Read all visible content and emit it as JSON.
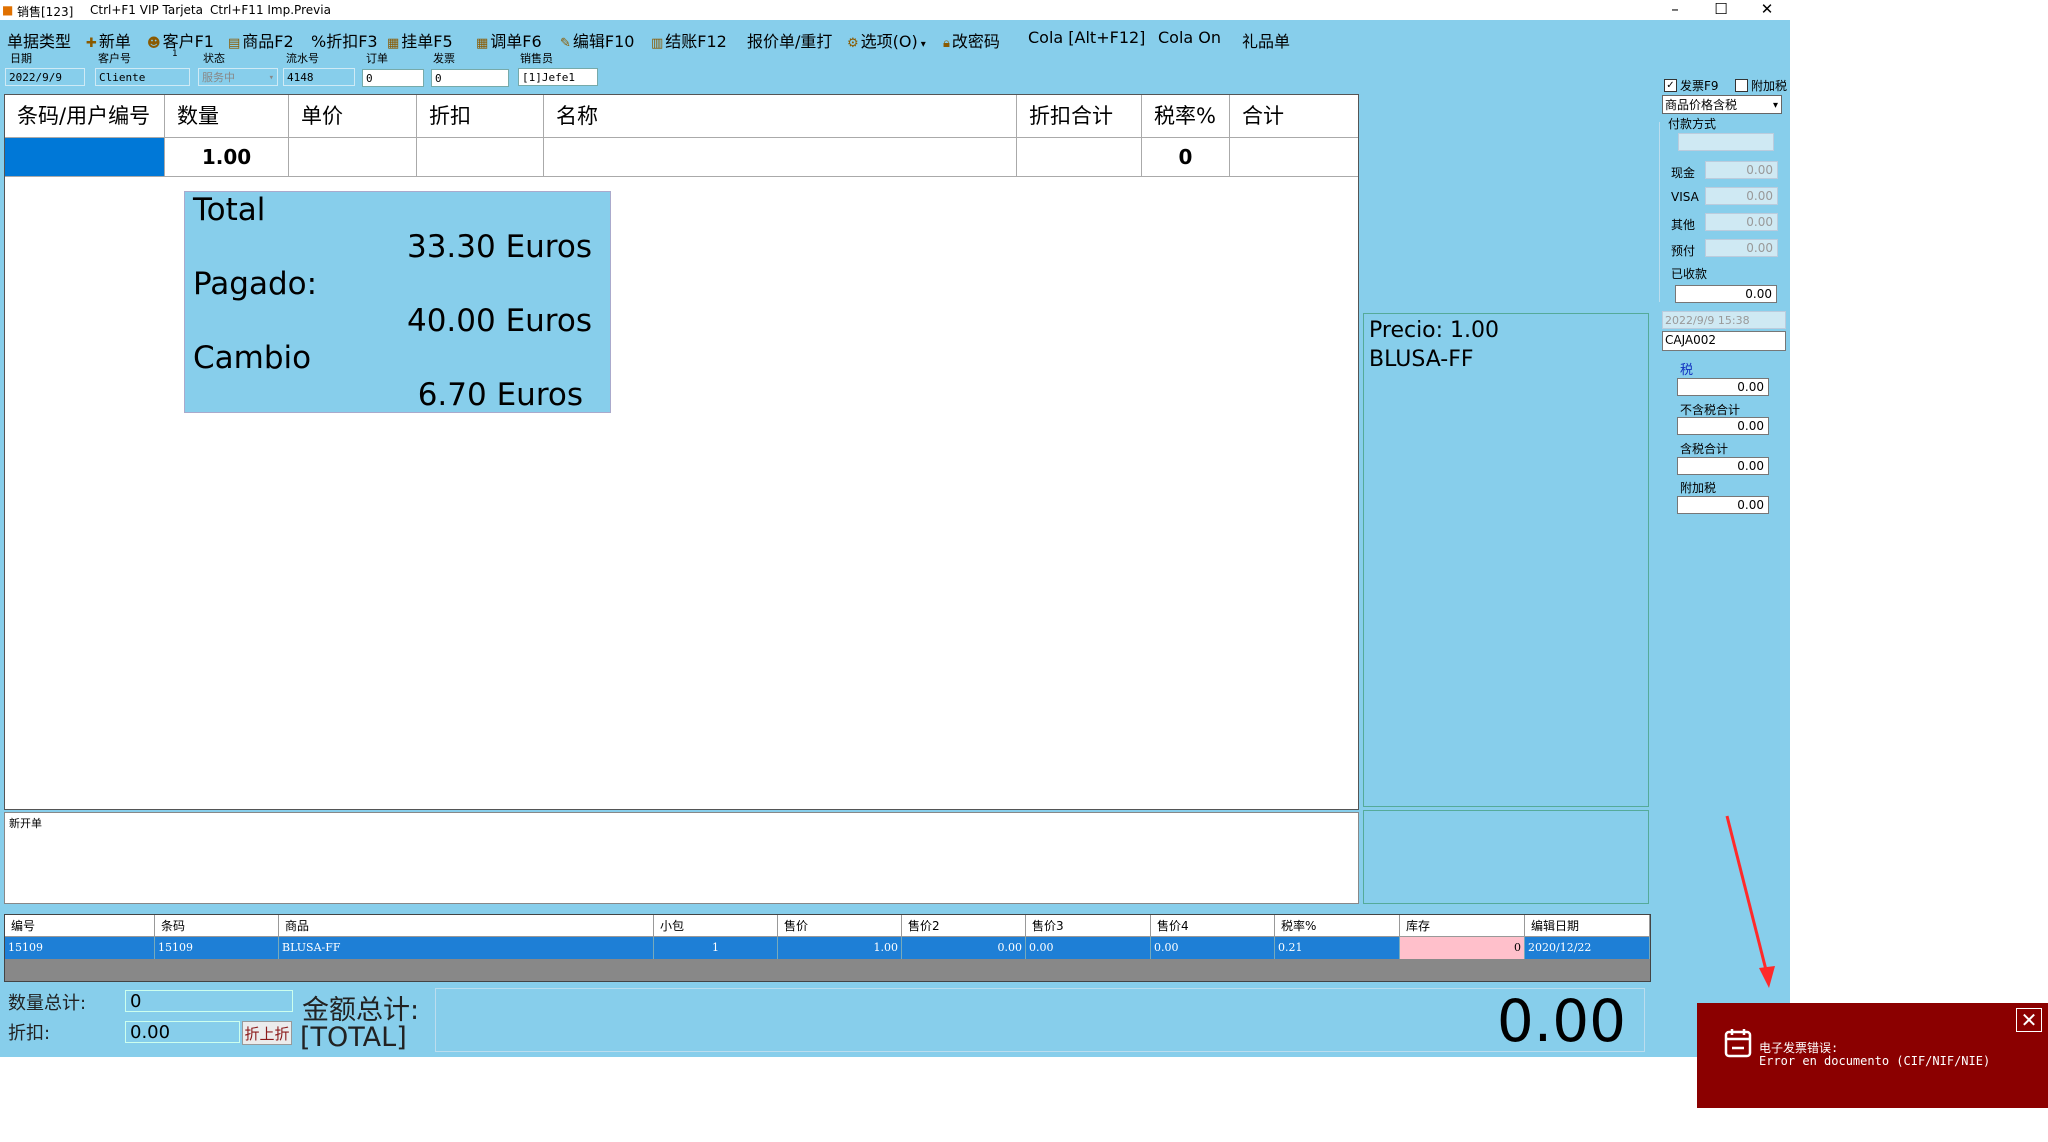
{
  "titlebar": {
    "title": "销售[123]",
    "shortcut1": "Ctrl+F1 VIP Tarjeta",
    "shortcut2": "Ctrl+F11 Imp.Previa"
  },
  "menu": [
    {
      "label": "单据类型",
      "icon": ""
    },
    {
      "label": "新单",
      "icon": "plus-icon"
    },
    {
      "label": "客户F1",
      "icon": "users-icon"
    },
    {
      "label": "商品F2",
      "icon": "box-icon"
    },
    {
      "label": "%折扣F3",
      "icon": ""
    },
    {
      "label": "挂单F5",
      "icon": "calc-icon"
    },
    {
      "label": "调单F6",
      "icon": "calendar-icon"
    },
    {
      "label": "编辑F10",
      "icon": "pencil-icon"
    },
    {
      "label": "结账F12",
      "icon": "receipt-icon"
    },
    {
      "label": "报价单/重打",
      "icon": ""
    },
    {
      "label": "选项(O)",
      "icon": "gear-icon"
    },
    {
      "label": "改密码",
      "icon": "lock-icon"
    },
    {
      "label": "Cola [Alt+F12]",
      "icon": ""
    },
    {
      "label": "Cola On",
      "icon": ""
    },
    {
      "label": "礼品单",
      "icon": ""
    }
  ],
  "header": {
    "date_label": "日期",
    "date_value": "2022/9/9",
    "customer_label": "客户号",
    "customer_value": "Cliente",
    "customer_mark": "1",
    "status_label": "状态",
    "status_value": "服务中",
    "serial_label": "流水号",
    "serial_value": "4148",
    "order_label": "订单",
    "order_value": "0",
    "invoice_label": "发票",
    "invoice_value": "0",
    "seller_label": "销售员",
    "seller_value": "[1]Jefe1"
  },
  "grid": {
    "columns": [
      "条码/用户编号",
      "数量",
      "单价",
      "折扣",
      "名称",
      "折扣合计",
      "税率%",
      "合计"
    ],
    "row": {
      "qty": "1.00",
      "tax": "0"
    }
  },
  "totals": {
    "total_label": "Total",
    "total_value": "33.30 Euros",
    "paid_label": "Pagado:",
    "paid_value": "40.00 Euros",
    "change_label": "Cambio",
    "change_value": "6.70 Euros"
  },
  "notes": {
    "text": "新开单"
  },
  "info": {
    "price": "Precio: 1.00",
    "product": "BLUSA-FF"
  },
  "right_panel": {
    "invoice_f9": "发票F9",
    "invoice_f9_checked": true,
    "surcharge": "附加税",
    "surcharge_checked": false,
    "price_mode": "商品价格含税",
    "payment_label": "付款方式",
    "cash_label": "现金",
    "cash_value": "0.00",
    "visa_label": "VISA",
    "visa_value": "0.00",
    "other_label": "其他",
    "other_value": "0.00",
    "prepaid_label": "预付",
    "prepaid_value": "0.00",
    "received_label": "已收款",
    "received_value": "0.00",
    "datetime": "2022/9/9 15:38",
    "register": "CAJA002",
    "tax_label": "税",
    "tax_value": "0.00",
    "net_label": "不含税合计",
    "net_value": "0.00",
    "gross_label": "含税合计",
    "gross_value": "0.00",
    "extra_tax_label": "附加税",
    "extra_tax_value": "0.00"
  },
  "products": {
    "columns": [
      "编号",
      "条码",
      "商品",
      "小包",
      "售价",
      "售价2",
      "售价3",
      "售价4",
      "税率%",
      "库存",
      "编辑日期"
    ],
    "rows": [
      [
        "15109",
        "15109",
        "BLUSA-FF",
        "1",
        "1.00",
        "0.00",
        "0.00",
        "0.00",
        "0.21",
        "0",
        "2020/12/22"
      ]
    ]
  },
  "footer": {
    "qty_label": "数量总计:",
    "qty_value": "0",
    "discount_label": "折扣:",
    "discount_value": "0.00",
    "discount_button": "折上折",
    "amount_label": "金额总计:",
    "amount_sub": "[TOTAL]",
    "amount_value": "0.00"
  },
  "toast": {
    "title": "电子发票错误:",
    "message": "Error en documento (CIF/NIF/NIE)"
  },
  "colors": {
    "panel": "#87ceeb",
    "selection": "#1e7fd6",
    "toast": "#8b0000",
    "stock_cell": "#ffc0cb"
  }
}
